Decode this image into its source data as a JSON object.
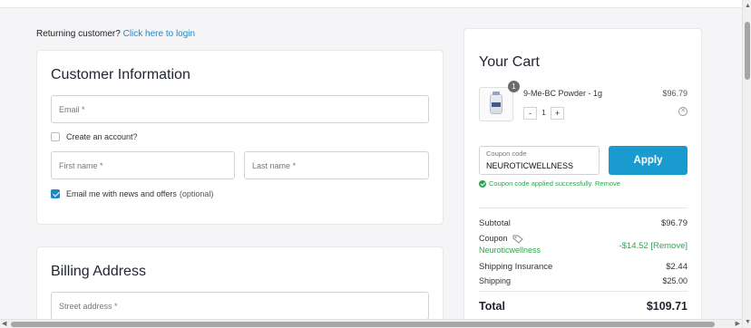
{
  "returning": {
    "text": "Returning customer?",
    "link": "Click here to login"
  },
  "customer": {
    "title": "Customer Information",
    "email_placeholder": "Email *",
    "create_account": "Create an account?",
    "first_name_placeholder": "First name *",
    "last_name_placeholder": "Last name *",
    "newsletter": "Email me with news and offers",
    "newsletter_optional": "(optional)",
    "newsletter_checked": true
  },
  "billing": {
    "title": "Billing Address",
    "street_placeholder": "Street address *"
  },
  "cart": {
    "title": "Your Cart",
    "item": {
      "name": "9-Me-BC Powder - 1g",
      "price": "$96.79",
      "qty": "1",
      "badge": "1"
    },
    "coupon_label": "Coupon code",
    "coupon_value": "NEUROTICWELLNESS",
    "apply_label": "Apply",
    "coupon_message": "Coupon code applied successfully. Remove",
    "subtotal_label": "Subtotal",
    "subtotal_value": "$96.79",
    "coupon_row_label": "Coupon",
    "coupon_row_code": "Neuroticwellness",
    "coupon_row_value": "-$14.52 [Remove]",
    "insurance_label": "Shipping Insurance",
    "insurance_value": "$2.44",
    "shipping_label": "Shipping",
    "shipping_value": "$25.00",
    "total_label": "Total",
    "total_value": "$109.71"
  },
  "colors": {
    "accent": "#1a9bd0",
    "success": "#2ea44f",
    "link": "#1e88c7"
  }
}
